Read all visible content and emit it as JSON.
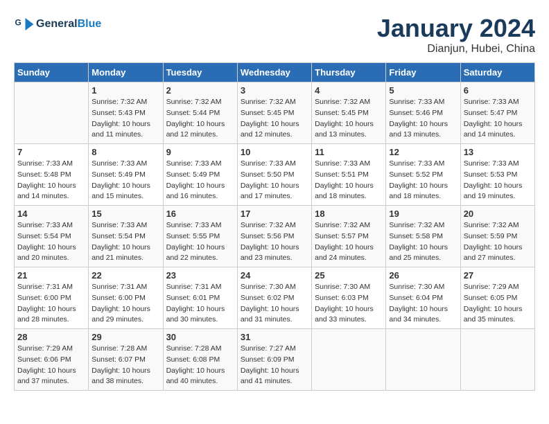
{
  "header": {
    "logo_general": "General",
    "logo_blue": "Blue",
    "month": "January 2024",
    "location": "Dianjun, Hubei, China"
  },
  "days_of_week": [
    "Sunday",
    "Monday",
    "Tuesday",
    "Wednesday",
    "Thursday",
    "Friday",
    "Saturday"
  ],
  "weeks": [
    [
      {
        "day": "",
        "info": ""
      },
      {
        "day": "1",
        "info": "Sunrise: 7:32 AM\nSunset: 5:43 PM\nDaylight: 10 hours\nand 11 minutes."
      },
      {
        "day": "2",
        "info": "Sunrise: 7:32 AM\nSunset: 5:44 PM\nDaylight: 10 hours\nand 12 minutes."
      },
      {
        "day": "3",
        "info": "Sunrise: 7:32 AM\nSunset: 5:45 PM\nDaylight: 10 hours\nand 12 minutes."
      },
      {
        "day": "4",
        "info": "Sunrise: 7:32 AM\nSunset: 5:45 PM\nDaylight: 10 hours\nand 13 minutes."
      },
      {
        "day": "5",
        "info": "Sunrise: 7:33 AM\nSunset: 5:46 PM\nDaylight: 10 hours\nand 13 minutes."
      },
      {
        "day": "6",
        "info": "Sunrise: 7:33 AM\nSunset: 5:47 PM\nDaylight: 10 hours\nand 14 minutes."
      }
    ],
    [
      {
        "day": "7",
        "info": "Sunrise: 7:33 AM\nSunset: 5:48 PM\nDaylight: 10 hours\nand 14 minutes."
      },
      {
        "day": "8",
        "info": "Sunrise: 7:33 AM\nSunset: 5:49 PM\nDaylight: 10 hours\nand 15 minutes."
      },
      {
        "day": "9",
        "info": "Sunrise: 7:33 AM\nSunset: 5:49 PM\nDaylight: 10 hours\nand 16 minutes."
      },
      {
        "day": "10",
        "info": "Sunrise: 7:33 AM\nSunset: 5:50 PM\nDaylight: 10 hours\nand 17 minutes."
      },
      {
        "day": "11",
        "info": "Sunrise: 7:33 AM\nSunset: 5:51 PM\nDaylight: 10 hours\nand 18 minutes."
      },
      {
        "day": "12",
        "info": "Sunrise: 7:33 AM\nSunset: 5:52 PM\nDaylight: 10 hours\nand 18 minutes."
      },
      {
        "day": "13",
        "info": "Sunrise: 7:33 AM\nSunset: 5:53 PM\nDaylight: 10 hours\nand 19 minutes."
      }
    ],
    [
      {
        "day": "14",
        "info": "Sunrise: 7:33 AM\nSunset: 5:54 PM\nDaylight: 10 hours\nand 20 minutes."
      },
      {
        "day": "15",
        "info": "Sunrise: 7:33 AM\nSunset: 5:54 PM\nDaylight: 10 hours\nand 21 minutes."
      },
      {
        "day": "16",
        "info": "Sunrise: 7:33 AM\nSunset: 5:55 PM\nDaylight: 10 hours\nand 22 minutes."
      },
      {
        "day": "17",
        "info": "Sunrise: 7:32 AM\nSunset: 5:56 PM\nDaylight: 10 hours\nand 23 minutes."
      },
      {
        "day": "18",
        "info": "Sunrise: 7:32 AM\nSunset: 5:57 PM\nDaylight: 10 hours\nand 24 minutes."
      },
      {
        "day": "19",
        "info": "Sunrise: 7:32 AM\nSunset: 5:58 PM\nDaylight: 10 hours\nand 25 minutes."
      },
      {
        "day": "20",
        "info": "Sunrise: 7:32 AM\nSunset: 5:59 PM\nDaylight: 10 hours\nand 27 minutes."
      }
    ],
    [
      {
        "day": "21",
        "info": "Sunrise: 7:31 AM\nSunset: 6:00 PM\nDaylight: 10 hours\nand 28 minutes."
      },
      {
        "day": "22",
        "info": "Sunrise: 7:31 AM\nSunset: 6:00 PM\nDaylight: 10 hours\nand 29 minutes."
      },
      {
        "day": "23",
        "info": "Sunrise: 7:31 AM\nSunset: 6:01 PM\nDaylight: 10 hours\nand 30 minutes."
      },
      {
        "day": "24",
        "info": "Sunrise: 7:30 AM\nSunset: 6:02 PM\nDaylight: 10 hours\nand 31 minutes."
      },
      {
        "day": "25",
        "info": "Sunrise: 7:30 AM\nSunset: 6:03 PM\nDaylight: 10 hours\nand 33 minutes."
      },
      {
        "day": "26",
        "info": "Sunrise: 7:30 AM\nSunset: 6:04 PM\nDaylight: 10 hours\nand 34 minutes."
      },
      {
        "day": "27",
        "info": "Sunrise: 7:29 AM\nSunset: 6:05 PM\nDaylight: 10 hours\nand 35 minutes."
      }
    ],
    [
      {
        "day": "28",
        "info": "Sunrise: 7:29 AM\nSunset: 6:06 PM\nDaylight: 10 hours\nand 37 minutes."
      },
      {
        "day": "29",
        "info": "Sunrise: 7:28 AM\nSunset: 6:07 PM\nDaylight: 10 hours\nand 38 minutes."
      },
      {
        "day": "30",
        "info": "Sunrise: 7:28 AM\nSunset: 6:08 PM\nDaylight: 10 hours\nand 40 minutes."
      },
      {
        "day": "31",
        "info": "Sunrise: 7:27 AM\nSunset: 6:09 PM\nDaylight: 10 hours\nand 41 minutes."
      },
      {
        "day": "",
        "info": ""
      },
      {
        "day": "",
        "info": ""
      },
      {
        "day": "",
        "info": ""
      }
    ]
  ]
}
